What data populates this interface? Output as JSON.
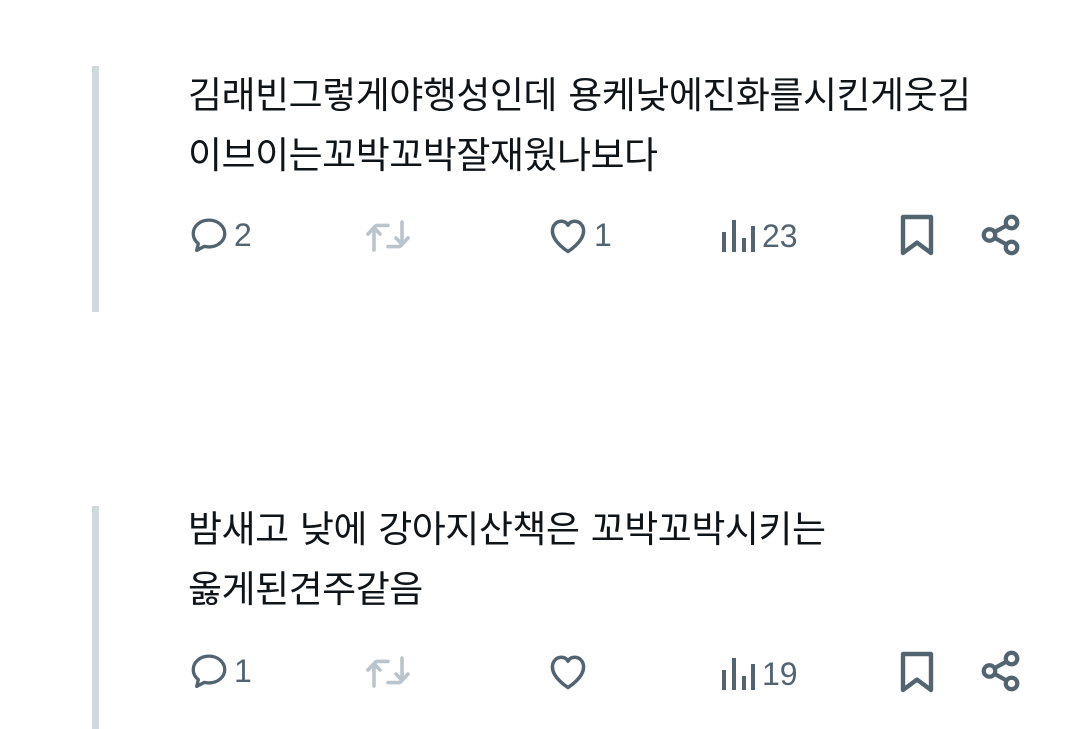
{
  "posts": [
    {
      "text_lines": [
        "김래빈그렇게야행성인데 용케낮에진화를시킨게웃김",
        "이브이는꼬박꼬박잘재웠나보다"
      ],
      "reply_count": "2",
      "repost_count": "",
      "like_count": "1",
      "view_count": "23"
    },
    {
      "text_lines": [
        "밤새고 낮에 강아지산책은 꼬박꼬박시키는",
        "옳게된견주같음"
      ],
      "reply_count": "1",
      "repost_count": "",
      "like_count": "",
      "view_count": "19"
    }
  ],
  "icons": {
    "reply": "speech-bubble-icon",
    "repost": "repost-arrows-icon",
    "like": "heart-icon",
    "views": "bar-chart-icon",
    "bookmark": "bookmark-icon",
    "share": "share-icon"
  },
  "colors": {
    "text": "#0f1419",
    "icon": "#536471",
    "thread_line": "#cfd9de"
  }
}
